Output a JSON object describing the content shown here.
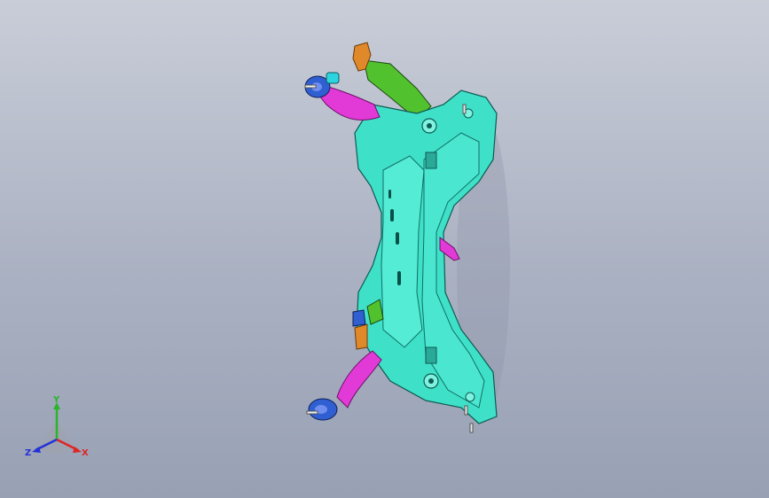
{
  "viewport": {
    "background_top": "#c9cdd8",
    "background_bottom": "#98a0b4"
  },
  "model": {
    "colors": {
      "frame": "#3fe0c8",
      "frame_dark": "#17857a",
      "arm": "#e23ad6",
      "bracket": "#e0892a",
      "bracket_green": "#52c12e",
      "bushing": "#2f5fd0"
    }
  },
  "triad": {
    "labels": {
      "y": "Y",
      "x": "X",
      "z": "Z"
    },
    "colors": {
      "y": "#2ab52a",
      "x": "#e02424",
      "z": "#2431d8"
    }
  }
}
